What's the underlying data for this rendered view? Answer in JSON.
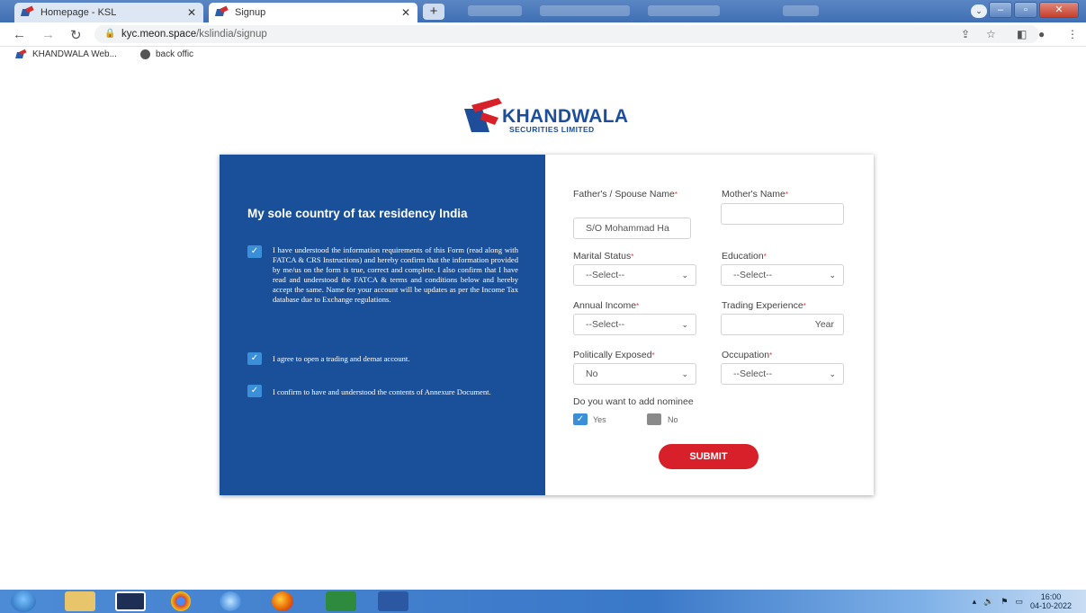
{
  "browser": {
    "tabs": [
      {
        "title": "Homepage - KSL",
        "active": false
      },
      {
        "title": "Signup",
        "active": true
      }
    ],
    "url_host": "kyc.meon.space",
    "url_path": "/kslindia/signup",
    "bookmarks": [
      {
        "label": "KHANDWALA Web...",
        "icon": "khandwala-favicon"
      },
      {
        "label": "back offic",
        "icon": "globe-icon"
      }
    ]
  },
  "logo": {
    "brand": "KHANDWALA",
    "sub": "SECURITIES LIMITED"
  },
  "declaration": {
    "heading": "My sole country of tax residency India",
    "items": [
      {
        "checked": true,
        "text": "I have understood the information requirements of this Form (read along with FATCA & CRS Instructions) and hereby confirm that the information provided by me/us on the form is true, correct and complete. I also confirm that I have read and understood the FATCA & terms and conditions below and hereby accept the same. Name for your account will be updates as per the Income Tax database due to Exchange regulations."
      },
      {
        "checked": true,
        "text": "I agree to open a trading and demat account."
      },
      {
        "checked": true,
        "text": "I confirm to have and understood the contents of Annexure Document."
      }
    ]
  },
  "form": {
    "father_label": "Father's / Spouse Name",
    "father_value": "S/O Mohammad Ha",
    "mother_label": "Mother's Name",
    "mother_value": "",
    "marital_label": "Marital Status",
    "marital_value": "--Select--",
    "education_label": "Education",
    "education_value": "--Select--",
    "income_label": "Annual Income",
    "income_value": "--Select--",
    "trading_label": "Trading Experience",
    "trading_suffix": "Year",
    "pep_label": "Politically Exposed",
    "pep_value": "No",
    "occupation_label": "Occupation",
    "occupation_value": "--Select--",
    "nominee_question": "Do you want to add nominee",
    "nominee_yes": "Yes",
    "nominee_no": "No",
    "nominee_selected": "Yes",
    "submit_label": "SUBMIT"
  },
  "taskbar": {
    "time": "16:00",
    "date": "04-10-2022"
  },
  "colors": {
    "brand_blue": "#1a5099",
    "accent_red": "#d8202a",
    "check_blue": "#3a8fd8"
  }
}
